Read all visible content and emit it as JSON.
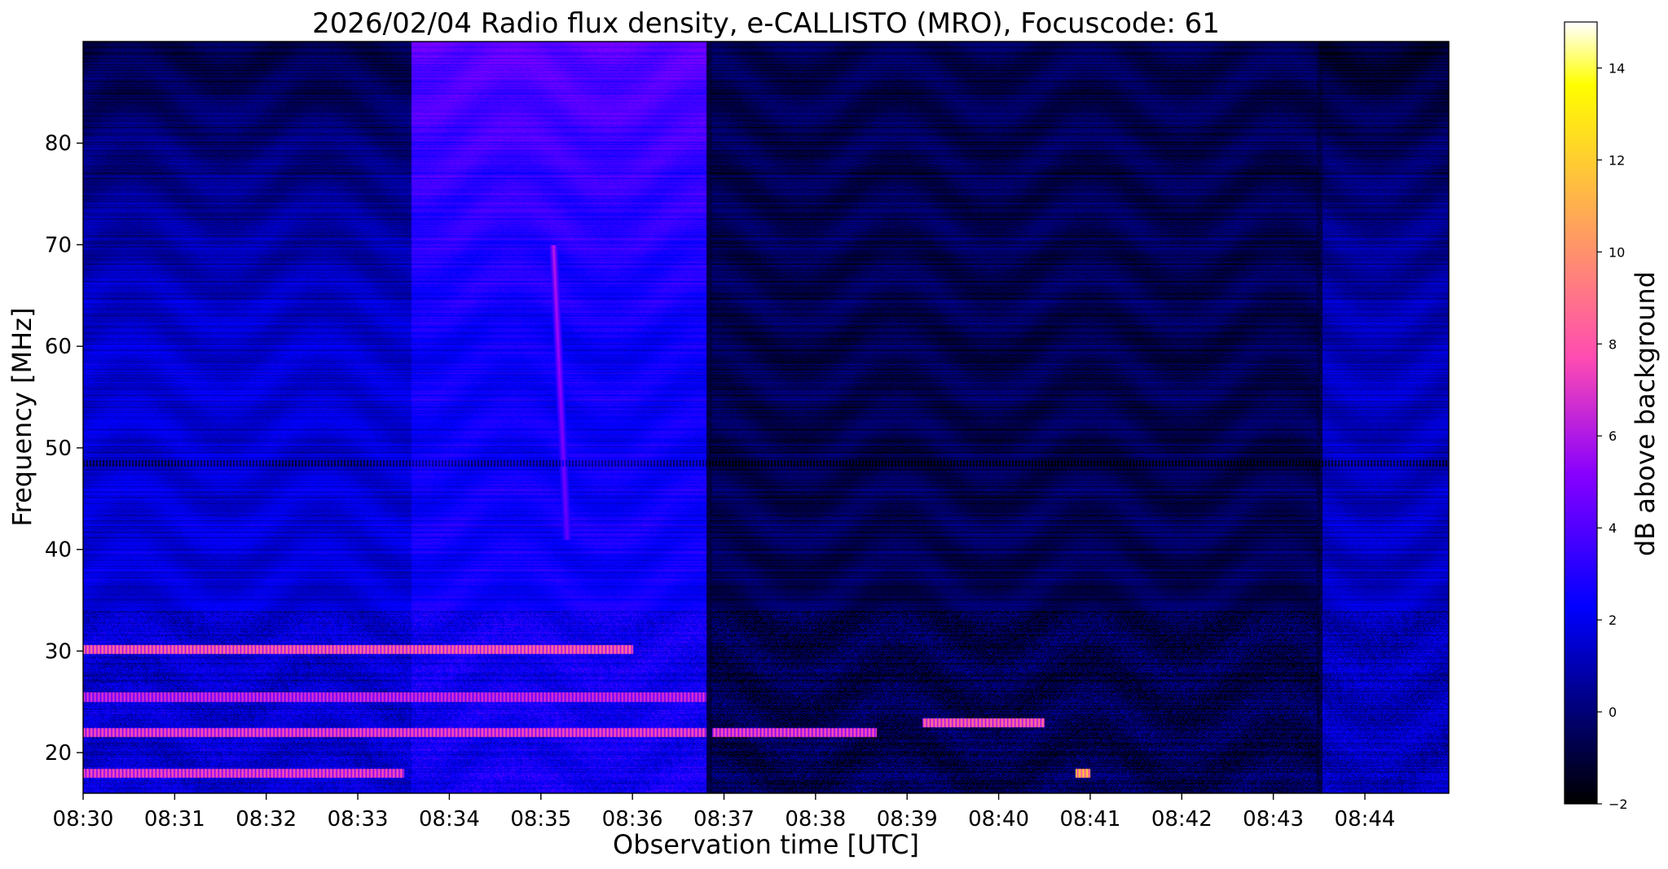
{
  "chart_data": {
    "type": "heatmap",
    "title": "2026/02/04  Radio flux density, e-CALLISTO (MRO), Focuscode: 61",
    "xlabel": "Observation time [UTC]",
    "ylabel": "Frequency [MHz]",
    "colorbar_label": "dB above background",
    "colormap": "gnuplot2",
    "x_ticks": [
      "08:30",
      "08:31",
      "08:32",
      "08:33",
      "08:34",
      "08:35",
      "08:36",
      "08:37",
      "08:38",
      "08:39",
      "08:40",
      "08:41",
      "08:42",
      "08:43",
      "08:44"
    ],
    "x_range": [
      "08:30:00",
      "08:44:55"
    ],
    "y_ticks": [
      20,
      30,
      40,
      50,
      60,
      70,
      80
    ],
    "y_range": [
      16,
      90
    ],
    "colorbar_ticks": [
      -2,
      0,
      2,
      4,
      6,
      8,
      10,
      12,
      14
    ],
    "colorbar_range": [
      -2,
      15
    ],
    "segments": [
      {
        "start": "08:30:00",
        "end": "08:33:35",
        "background_level_db": 1.6
      },
      {
        "start": "08:33:35",
        "end": "08:36:50",
        "background_level_db": 2.4
      },
      {
        "start": "08:36:50",
        "end": "08:43:30",
        "background_level_db": -0.6
      },
      {
        "start": "08:43:30",
        "end": "08:44:55",
        "background_level_db": 1.2
      }
    ],
    "features": [
      {
        "kind": "type_III_burst",
        "time_start": "08:35:08",
        "time_end": "08:35:17",
        "freq_start_mhz": 70,
        "freq_end_mhz": 41,
        "peak_db": 4
      },
      {
        "kind": "narrowband_interference",
        "freq_mhz": 30.2,
        "time_start": "08:30:00",
        "time_end": "08:36:00",
        "peak_db": 9
      },
      {
        "kind": "narrowband_interference",
        "freq_mhz": 25.5,
        "time_start": "08:30:00",
        "time_end": "08:36:50",
        "peak_db": 7
      },
      {
        "kind": "narrowband_interference",
        "freq_mhz": 22.0,
        "time_start": "08:30:00",
        "time_end": "08:38:40",
        "peak_db": 8
      },
      {
        "kind": "narrowband_interference",
        "freq_mhz": 18.0,
        "time_start": "08:30:00",
        "time_end": "08:33:30",
        "peak_db": 8
      },
      {
        "kind": "narrowband_interference",
        "freq_mhz": 23.0,
        "time_start": "08:39:10",
        "time_end": "08:40:30",
        "peak_db": 9
      },
      {
        "kind": "narrowband_interference",
        "freq_mhz": 18.0,
        "time_start": "08:40:50",
        "time_end": "08:41:00",
        "peak_db": 12
      },
      {
        "kind": "broadband_spike",
        "time": "08:36:50"
      },
      {
        "kind": "broadband_spike",
        "time": "08:43:30"
      }
    ]
  }
}
